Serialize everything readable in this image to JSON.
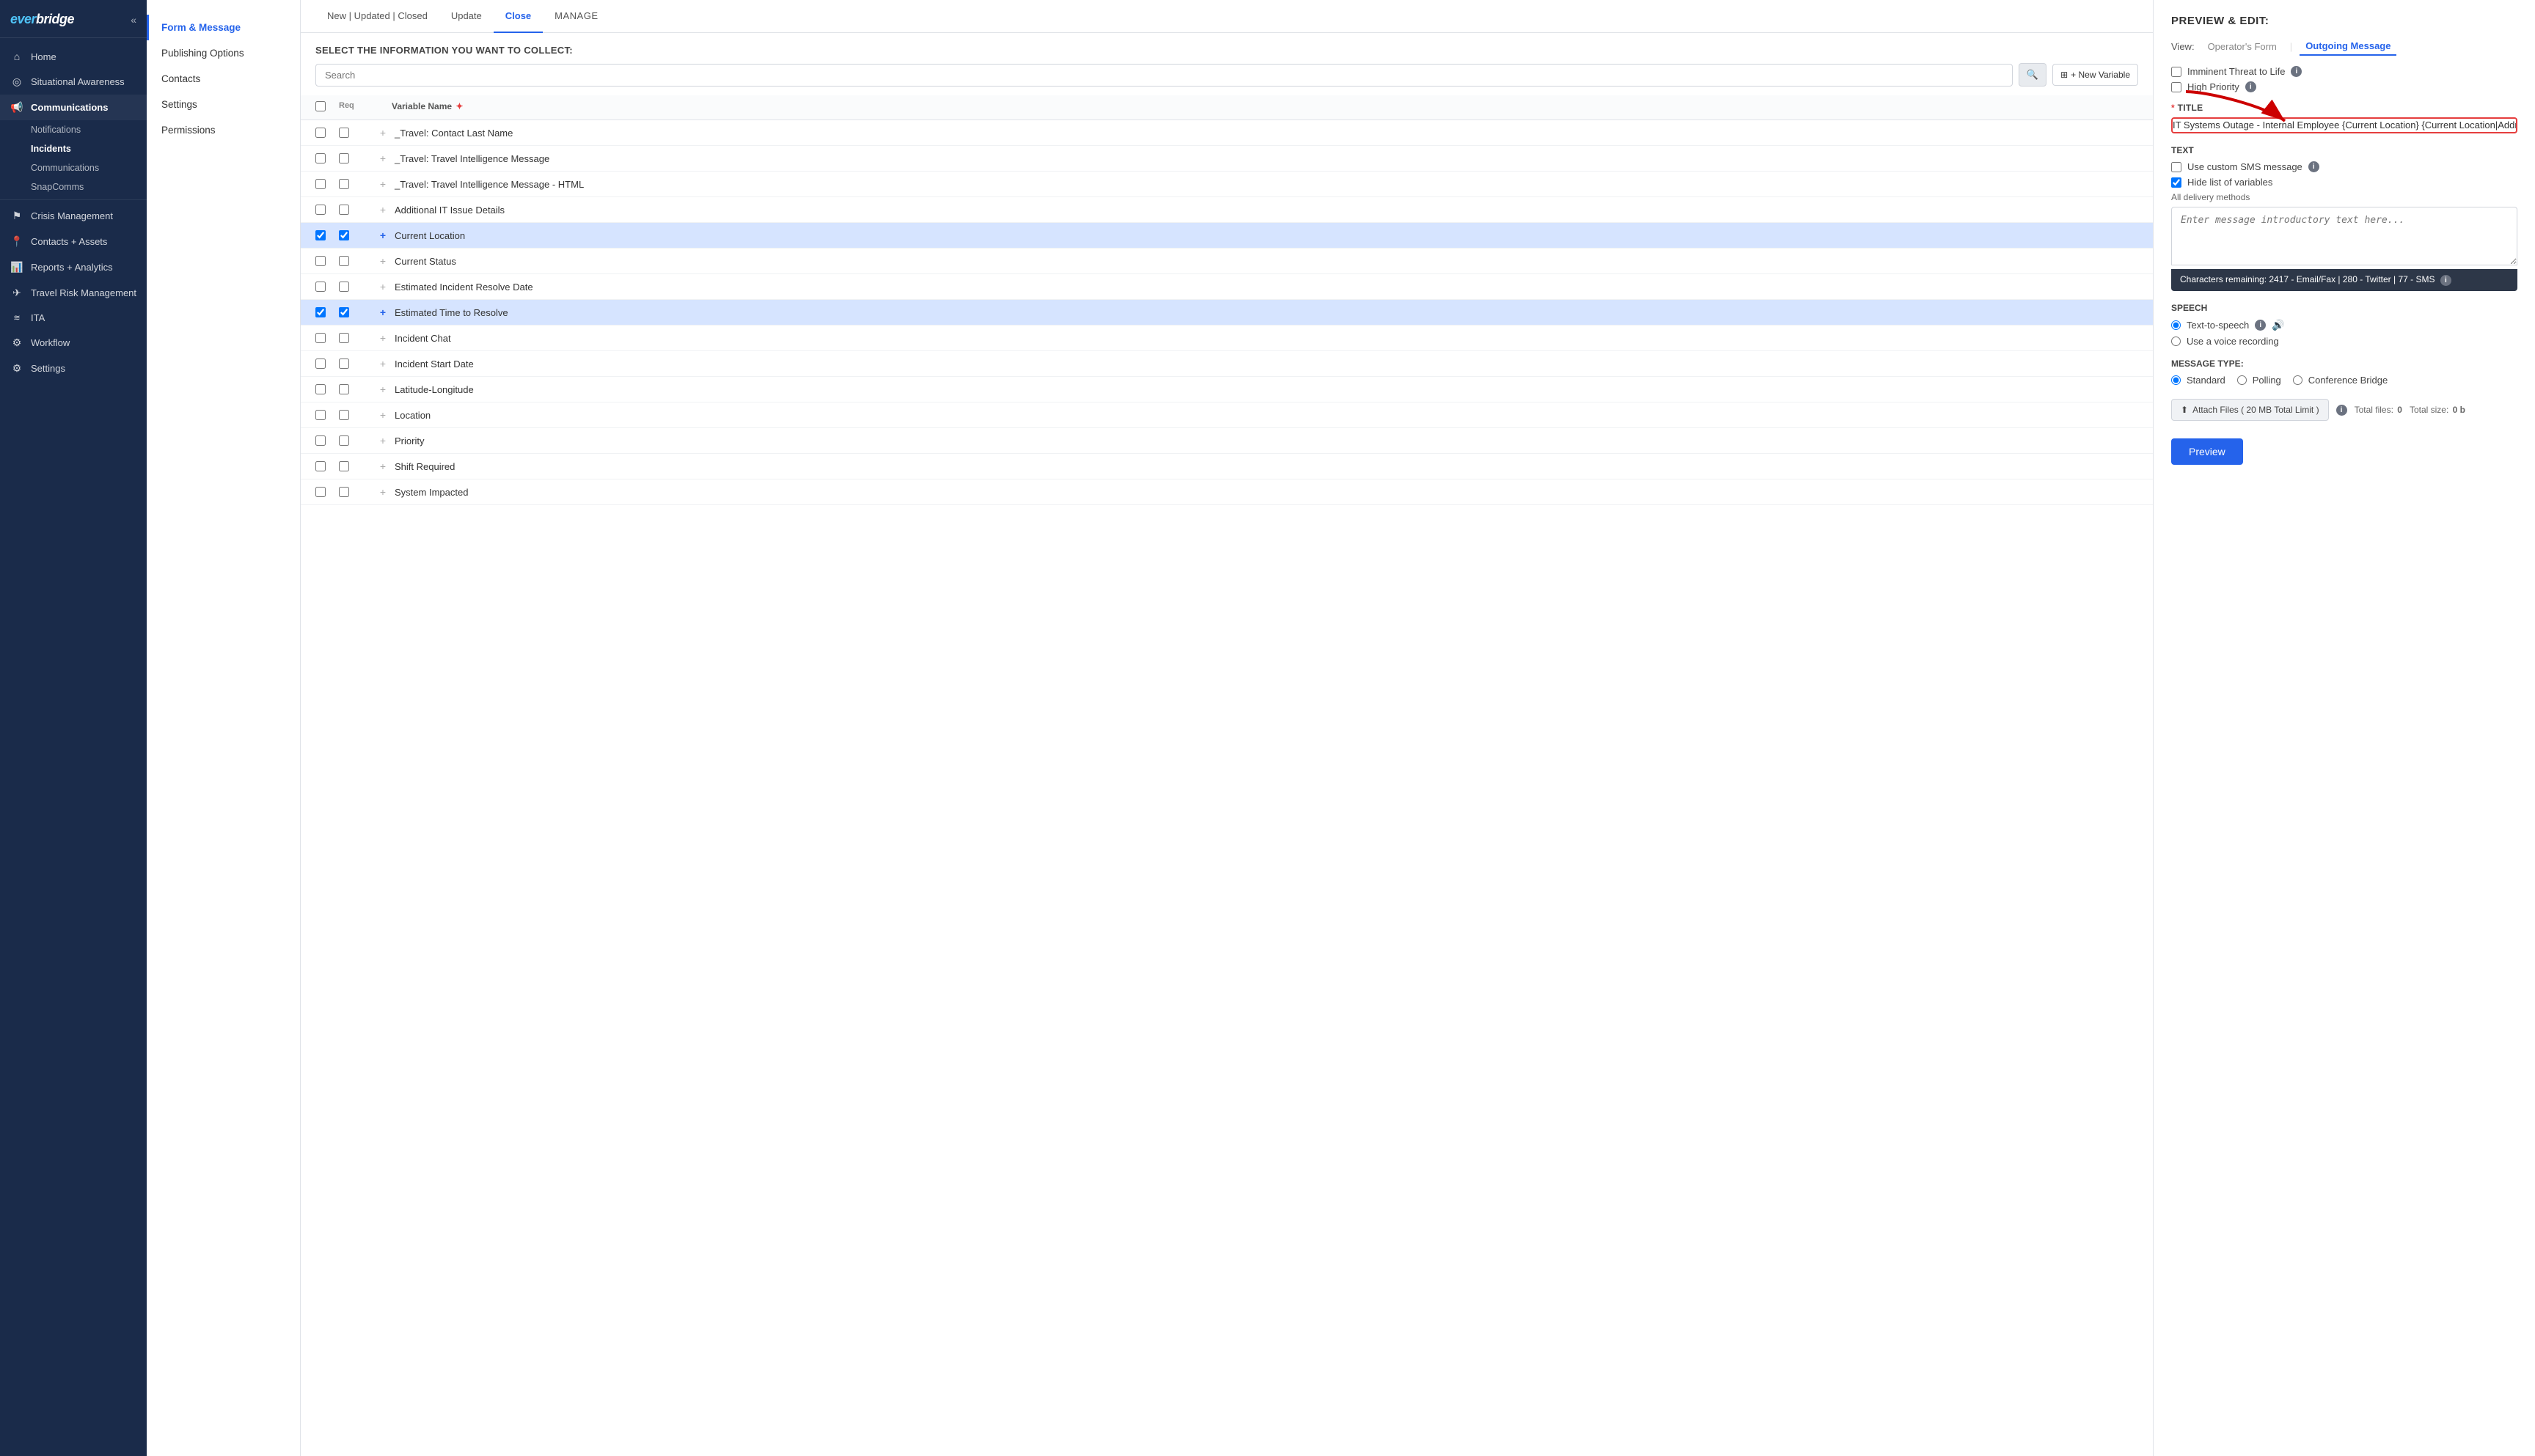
{
  "sidebar": {
    "logo": "everbridge",
    "collapse_label": "«",
    "items": [
      {
        "id": "home",
        "label": "Home",
        "icon": "⌂",
        "active": false
      },
      {
        "id": "situational-awareness",
        "label": "Situational Awareness",
        "icon": "◎",
        "active": false
      },
      {
        "id": "communications",
        "label": "Communications",
        "icon": "📢",
        "active": true,
        "children": [
          {
            "id": "notifications",
            "label": "Notifications"
          },
          {
            "id": "incidents",
            "label": "Incidents",
            "bold": true
          },
          {
            "id": "comms",
            "label": "Communications"
          },
          {
            "id": "snapcomms",
            "label": "SnapComms"
          }
        ]
      },
      {
        "id": "crisis-management",
        "label": "Crisis Management",
        "icon": "⚑",
        "active": false
      },
      {
        "id": "contacts-assets",
        "label": "Contacts + Assets",
        "icon": "📍",
        "active": false
      },
      {
        "id": "reports-analytics",
        "label": "Reports + Analytics",
        "icon": "📊",
        "active": false
      },
      {
        "id": "travel-risk",
        "label": "Travel Risk Management",
        "icon": "✈",
        "active": false
      },
      {
        "id": "ita",
        "label": "ITA",
        "icon": "~",
        "active": false
      },
      {
        "id": "workflow",
        "label": "Workflow",
        "icon": "⚙",
        "active": false
      },
      {
        "id": "settings",
        "label": "Settings",
        "icon": "⚙",
        "active": false
      }
    ]
  },
  "subnav": {
    "items": [
      {
        "id": "form-message",
        "label": "Form & Message",
        "active": true
      },
      {
        "id": "publishing-options",
        "label": "Publishing Options",
        "active": false
      },
      {
        "id": "contacts",
        "label": "Contacts",
        "active": false
      },
      {
        "id": "settings",
        "label": "Settings",
        "active": false
      },
      {
        "id": "permissions",
        "label": "Permissions",
        "active": false
      }
    ]
  },
  "tabs": {
    "items": [
      {
        "id": "new-updated-closed",
        "label": "New | Updated | Closed",
        "active": false
      },
      {
        "id": "update",
        "label": "Update",
        "active": false
      },
      {
        "id": "close",
        "label": "Close",
        "active": true
      },
      {
        "id": "manage",
        "label": "MANAGE",
        "active": false
      }
    ]
  },
  "select_info": {
    "heading": "Select the information you want to collect:"
  },
  "search": {
    "placeholder": "Search",
    "search_btn_icon": "🔍",
    "new_variable_label": "+ New Variable"
  },
  "table": {
    "headers": {
      "req": "Req",
      "variable_name": "Variable Name"
    },
    "rows": [
      {
        "id": 1,
        "name": "_Travel: Contact Last Name",
        "checked1": false,
        "checked2": false,
        "selected": false
      },
      {
        "id": 2,
        "name": "_Travel: Travel Intelligence Message",
        "checked1": false,
        "checked2": false,
        "selected": false
      },
      {
        "id": 3,
        "name": "_Travel: Travel Intelligence Message - HTML",
        "checked1": false,
        "checked2": false,
        "selected": false
      },
      {
        "id": 4,
        "name": "Additional IT Issue Details",
        "checked1": false,
        "checked2": false,
        "selected": false
      },
      {
        "id": 5,
        "name": "Current Location",
        "checked1": true,
        "checked2": true,
        "selected": true
      },
      {
        "id": 6,
        "name": "Current Status",
        "checked1": false,
        "checked2": false,
        "selected": false
      },
      {
        "id": 7,
        "name": "Estimated Incident Resolve Date",
        "checked1": false,
        "checked2": false,
        "selected": false
      },
      {
        "id": 8,
        "name": "Estimated Time to Resolve",
        "checked1": true,
        "checked2": true,
        "selected": true
      },
      {
        "id": 9,
        "name": "Incident Chat",
        "checked1": false,
        "checked2": false,
        "selected": false
      },
      {
        "id": 10,
        "name": "Incident Start Date",
        "checked1": false,
        "checked2": false,
        "selected": false
      },
      {
        "id": 11,
        "name": "Latitude-Longitude",
        "checked1": false,
        "checked2": false,
        "selected": false
      },
      {
        "id": 12,
        "name": "Location",
        "checked1": false,
        "checked2": false,
        "selected": false
      },
      {
        "id": 13,
        "name": "Priority",
        "checked1": false,
        "checked2": false,
        "selected": false
      },
      {
        "id": 14,
        "name": "Shift Required",
        "checked1": false,
        "checked2": false,
        "selected": false
      },
      {
        "id": 15,
        "name": "System Impacted",
        "checked1": false,
        "checked2": false,
        "selected": false
      }
    ]
  },
  "preview": {
    "heading": "Preview & Edit:",
    "view_label": "View:",
    "view_options": [
      {
        "id": "operators-form",
        "label": "Operator's Form",
        "active": false
      },
      {
        "id": "outgoing-message",
        "label": "Outgoing Message",
        "active": true
      }
    ],
    "options": [
      {
        "id": "imminent-threat",
        "label": "Imminent Threat to Life",
        "checked": false,
        "has_info": true
      },
      {
        "id": "high-priority",
        "label": "High Priority",
        "checked": false,
        "has_info": true
      }
    ],
    "title_field": {
      "label": "* TITLE",
      "required": "*",
      "value": "IT Systems Outage - Internal Employee {Current Location} {Current Location|Address}"
    },
    "text_section": {
      "label": "TEXT",
      "use_custom_sms_label": "Use custom SMS message",
      "hide_list_label": "Hide list of variables",
      "use_custom_checked": false,
      "hide_list_checked": true,
      "delivery_label": "All delivery methods",
      "textarea_placeholder": "Enter message introductory text here...",
      "char_count": "Characters remaining:  2417 - Email/Fax  |  280 - Twitter  |  77 - SMS"
    },
    "speech": {
      "label": "SPEECH",
      "text_to_speech_label": "Text-to-speech",
      "voice_recording_label": "Use a voice recording",
      "selected": "text-to-speech"
    },
    "message_type": {
      "label": "MESSAGE TYPE:",
      "options": [
        {
          "id": "standard",
          "label": "Standard",
          "selected": true
        },
        {
          "id": "polling",
          "label": "Polling",
          "selected": false
        },
        {
          "id": "conference-bridge",
          "label": "Conference Bridge",
          "selected": false
        }
      ],
      "attach_label": "Attach Files ( 20 MB Total Limit )",
      "total_files_label": "Total files:",
      "total_files_value": "0",
      "total_size_label": "Total size:",
      "total_size_value": "0 b"
    },
    "preview_btn": "Preview"
  }
}
